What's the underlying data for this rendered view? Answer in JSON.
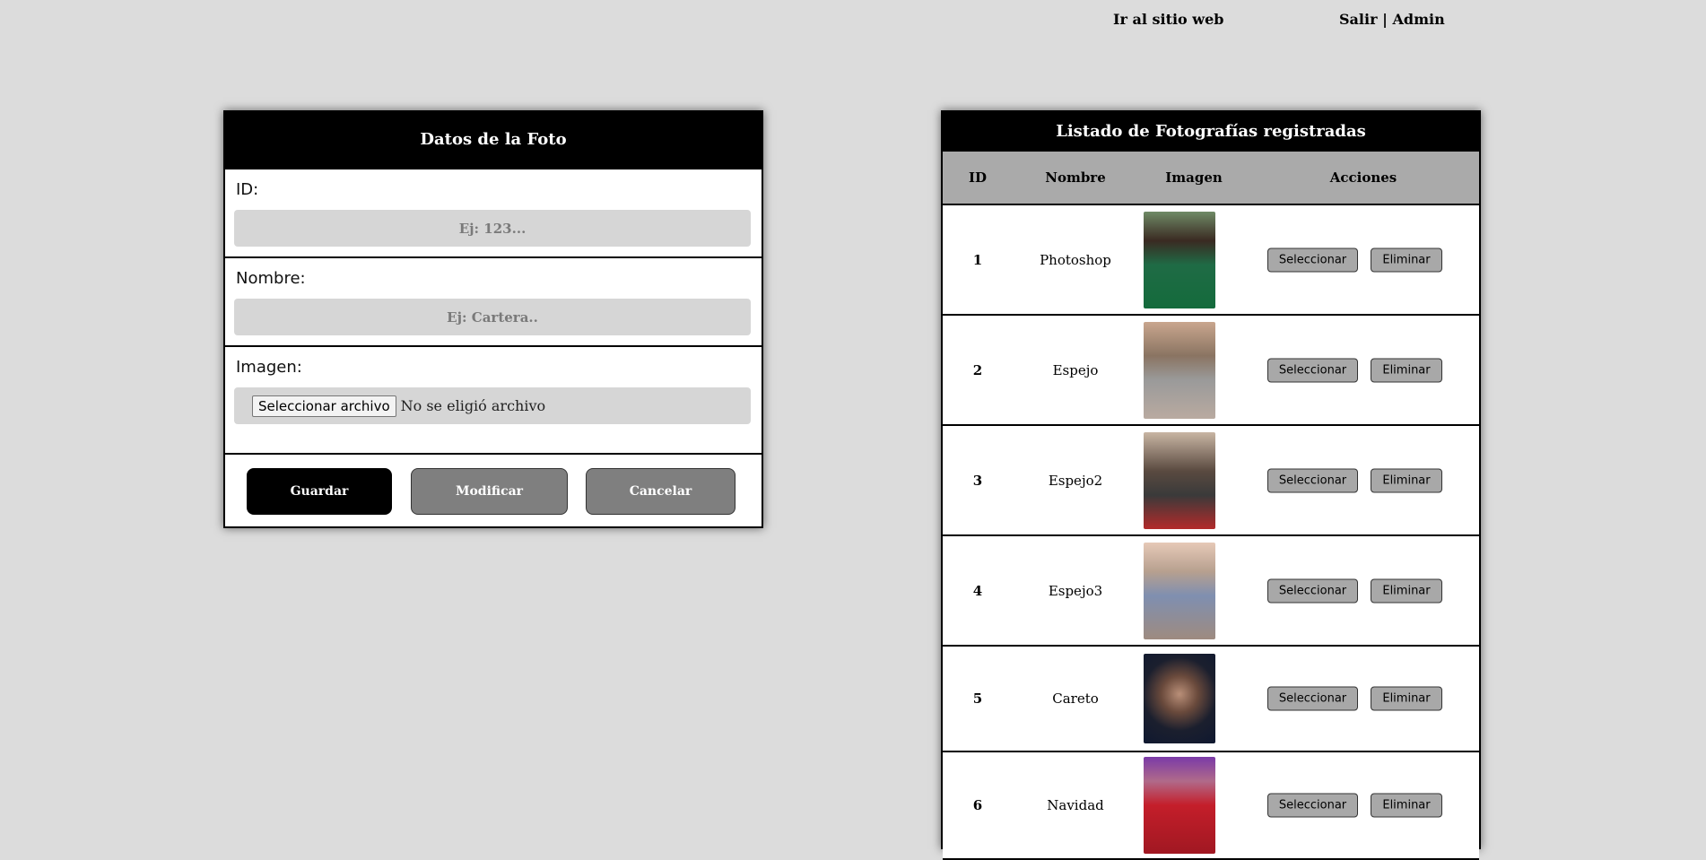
{
  "top_nav": {
    "site_link": "Ir al sitio web",
    "logout_link": "Salir | Admin"
  },
  "form": {
    "title": "Datos de la Foto",
    "id_label": "ID:",
    "id_placeholder": "Ej: 123...",
    "name_label": "Nombre:",
    "name_placeholder": "Ej: Cartera..",
    "image_label": "Imagen:",
    "file_button": "Seleccionar archivo",
    "file_status": "No se eligió archivo",
    "save_button": "Guardar",
    "modify_button": "Modificar",
    "cancel_button": "Cancelar"
  },
  "list": {
    "title": "Listado de Fotografías registradas",
    "headers": [
      "ID",
      "Nombre",
      "Imagen",
      "Acciones"
    ],
    "select_label": "Seleccionar",
    "delete_label": "Eliminar",
    "rows": [
      {
        "id": "1",
        "name": "Photoshop"
      },
      {
        "id": "2",
        "name": "Espejo"
      },
      {
        "id": "3",
        "name": "Espejo2"
      },
      {
        "id": "4",
        "name": "Espejo3"
      },
      {
        "id": "5",
        "name": "Careto"
      },
      {
        "id": "6",
        "name": "Navidad"
      }
    ]
  },
  "colors": {
    "page_bg": "#dcdcdc",
    "header_bg": "#000000",
    "table_head_bg": "#aaaaaa",
    "input_bg": "#d6d6d6",
    "secondary_button": "#7f7f7f"
  }
}
